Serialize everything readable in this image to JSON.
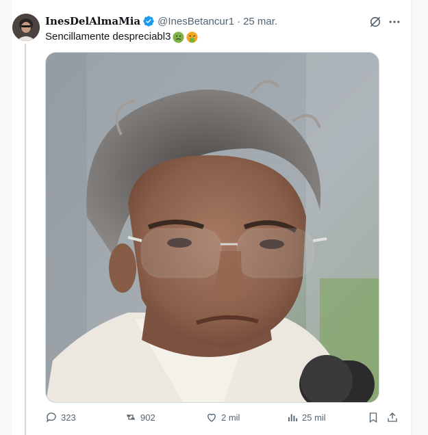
{
  "tweet": {
    "display_name": "InesDelAlmaMia",
    "handle": "@InesBetancur1",
    "separator": "·",
    "date": "25 mar.",
    "text": "Sencillamente despreciabl3",
    "emojis": [
      "nauseated-face-emoji",
      "vomiting-face-emoji"
    ],
    "verified": true,
    "image_alt_icon": "photo-of-man-with-glasses"
  },
  "actions": {
    "replies": "323",
    "reposts": "902",
    "likes": "2 mil",
    "views": "25 mil"
  },
  "colors": {
    "verified_blue": "#1d9bf0",
    "muted_text": "#536471",
    "text": "#0f1419"
  }
}
